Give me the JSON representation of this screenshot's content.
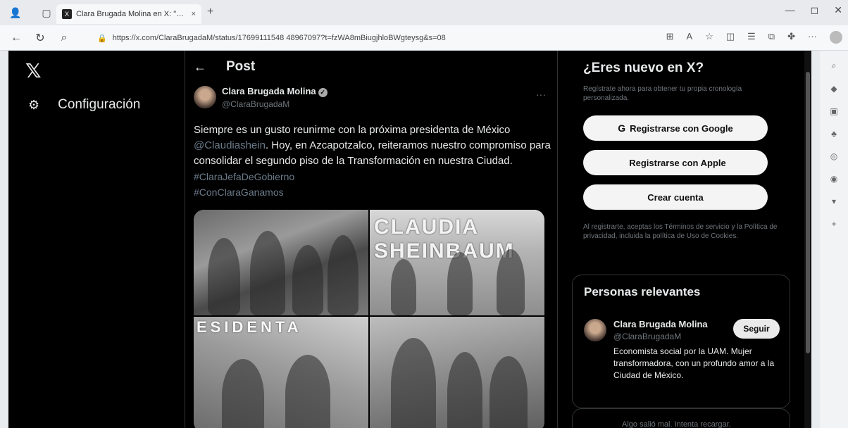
{
  "browser": {
    "tab_title": "Clara Brugada Molina en X: \"Sie",
    "tab_favicon": "X",
    "tab_close": "×",
    "new_tab": "+",
    "window_controls": [
      "—",
      "◻",
      "✕"
    ],
    "url": "https://x.com/ClaraBrugadaM/status/17699111548 48967097?t=fzWA8mBiugjhloBWgteysg&s=08",
    "tool_icons": [
      "reader-icon",
      "read-aloud-icon",
      "favorite-icon",
      "split-screen-icon",
      "favorites-icon",
      "collections-icon",
      "extensions-icon",
      "more-icon",
      "profile-icon"
    ]
  },
  "sidebar": {
    "logo": "𝕏",
    "config_label": "Configuración",
    "config_icon": "⚙"
  },
  "post": {
    "header": "Post",
    "back_icon": "←",
    "author_name": "Clara Brugada Molina",
    "author_handle": "@ClaraBrugadaM",
    "more": "···",
    "text_1": "Siempre es un gusto reunirme con la próxima presidenta de México",
    "mention": "@Claudiashein",
    "text_2": ". Hoy, en  Azcapotzalco, reiteramos nuestro compromiso para consolidar el segundo piso de la Transformación en nuestra Ciudad.",
    "hashtag_1": "#ClaraJefaDeGobierno",
    "hashtag_2": "#ConClaraGanamos",
    "photo_2_banner": "CLAUDIA SHEINBAUM",
    "photo_3_banner": "ESIDENTA"
  },
  "right": {
    "title": "¿Eres nuevo en X?",
    "subtitle": "Regístrate ahora para obtener tu propia cronología personalizada.",
    "google_btn": "Registrarse con Google",
    "apple_btn": "Registrarse con Apple",
    "create_btn": "Crear cuenta",
    "legal": "Al registrarte, aceptas los Términos de servicio y la Política de privacidad, incluida la política de Uso de Cookies.",
    "people_title": "Personas relevantes",
    "person_name": "Clara Brugada Molina",
    "person_handle": "@ClaraBrugadaM",
    "person_bio": "Economista social por la UAM. Mujer transformadora, con un profundo amor a la Ciudad de México.",
    "follow_btn": "Seguir",
    "error_text": "Algo salió mal. Intenta recargar."
  }
}
